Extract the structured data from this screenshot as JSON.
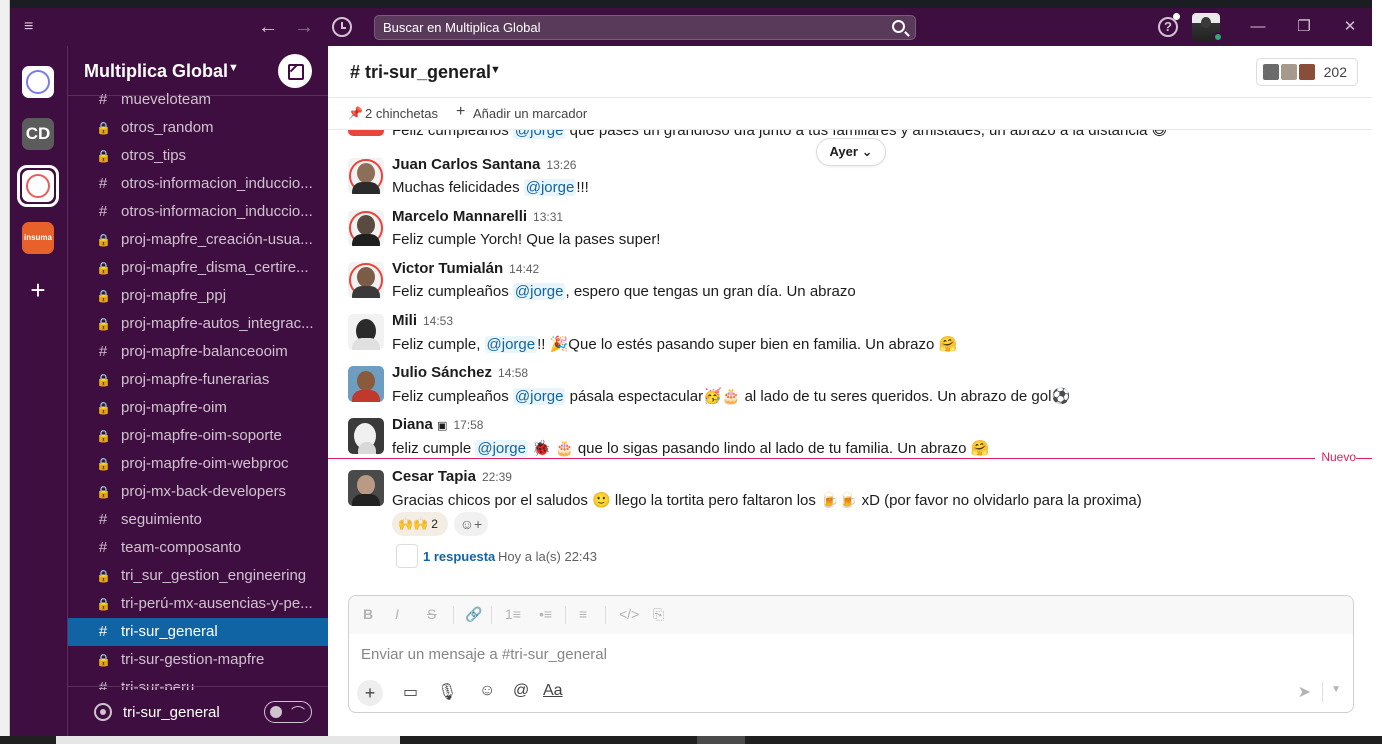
{
  "titlebar": {
    "search_placeholder": "Buscar en Multiplica Global",
    "back_icon": "arrow-left",
    "forward_icon": "arrow-right",
    "history_icon": "clock",
    "help_icon": "question",
    "minimize": "—",
    "maximize": "❐",
    "close": "✕"
  },
  "rail": {
    "workspaces": [
      {
        "icon": "circle-outline-blue"
      },
      {
        "label": "CD"
      },
      {
        "icon": "circle-outline-red",
        "active": true
      },
      {
        "label": "insuma"
      }
    ],
    "add_label": "+"
  },
  "sidebar": {
    "workspace_name": "Multiplica Global",
    "channels": [
      {
        "prefix": "#",
        "name": "mueveloteam"
      },
      {
        "prefix": "lock",
        "name": "otros_random"
      },
      {
        "prefix": "lock",
        "name": "otros_tips"
      },
      {
        "prefix": "#",
        "name": "otros-informacion_induccio..."
      },
      {
        "prefix": "#",
        "name": "otros-informacion_induccio..."
      },
      {
        "prefix": "lock",
        "name": "proj-mapfre_creación-usua..."
      },
      {
        "prefix": "lock",
        "name": "proj-mapfre_disma_certire..."
      },
      {
        "prefix": "lock",
        "name": "proj-mapfre_ppj"
      },
      {
        "prefix": "lock",
        "name": "proj-mapfre-autos_integrac..."
      },
      {
        "prefix": "#",
        "name": "proj-mapfre-balanceooim"
      },
      {
        "prefix": "lock",
        "name": "proj-mapfre-funerarias"
      },
      {
        "prefix": "lock",
        "name": "proj-mapfre-oim"
      },
      {
        "prefix": "lock",
        "name": "proj-mapfre-oim-soporte"
      },
      {
        "prefix": "lock",
        "name": "proj-mapfre-oim-webproc"
      },
      {
        "prefix": "lock",
        "name": "proj-mx-back-developers"
      },
      {
        "prefix": "#",
        "name": "seguimiento"
      },
      {
        "prefix": "#",
        "name": "team-composanto"
      },
      {
        "prefix": "lock",
        "name": "tri_sur_gestion_engineering"
      },
      {
        "prefix": "lock",
        "name": "tri-perú-mx-ausencias-y-pe..."
      },
      {
        "prefix": "#",
        "name": "tri-sur_general",
        "active": true
      },
      {
        "prefix": "lock",
        "name": "tri-sur-gestion-mapfre"
      },
      {
        "prefix": "#",
        "name": "tri-sur-peru"
      }
    ],
    "footer_label": "tri-sur_general"
  },
  "channel": {
    "title": "# tri-sur_general",
    "member_count": "202",
    "pins_label": "2 chinchetas",
    "add_bookmark_label": "Añadir un marcador",
    "day_label": "Ayer"
  },
  "messages": [
    {
      "author": "",
      "time": "",
      "text_before": "Feliz cumpleaños ",
      "mention": "@jorge",
      "text_after": " que pases un grandioso día junto a tus familiares y amistades, un abrazo a la distancia ",
      "emoji": "😄"
    },
    {
      "author": "Juan Carlos Santana",
      "time": "13:26",
      "text_before": "Muchas felicidades ",
      "mention": "@jorge",
      "text_after": "!!!",
      "emoji": ""
    },
    {
      "author": "Marcelo Mannarelli",
      "time": "13:31",
      "text_before": "Feliz cumple Yorch! Que la pases super!",
      "mention": "",
      "text_after": "",
      "emoji": ""
    },
    {
      "author": "Victor Tumialán",
      "time": "14:42",
      "text_before": "Feliz cumpleaños ",
      "mention": "@jorge",
      "text_after": ", espero que tengas un gran día. Un abrazo",
      "emoji": ""
    },
    {
      "author": "Mili",
      "time": "14:53",
      "text_before": "Feliz cumple, ",
      "mention": "@jorge",
      "text_after": "!! 🎉Que lo estés pasando super bien en familia. Un abrazo ",
      "emoji": "🤗"
    },
    {
      "author": "Julio Sánchez",
      "time": "14:58",
      "text_before": "Feliz cumpleaños ",
      "mention": "@jorge",
      "text_after": " pásala espectacular🥳🎂 al lado de tu seres queridos. Un abrazo de gol",
      "emoji": "⚽"
    },
    {
      "author": "Diana",
      "time": "17:58",
      "text_before": "feliz cumple ",
      "mention": "@jorge",
      "text_after": " 🐞 🎂  que lo sigas pasando lindo al lado de tu familia. Un abrazo ",
      "emoji": "🤗"
    },
    {
      "author": "Cesar Tapia",
      "time": "22:39",
      "text_before": "Gracias chicos por el saludos 🙂 llego la tortita pero faltaron los 🍺🍺 xD (por favor no olvidarlo para la proxima)",
      "mention": "",
      "text_after": "",
      "emoji": ""
    }
  ],
  "new_label": "Nuevo",
  "reaction": {
    "emoji": "🙌🙌",
    "count": "2"
  },
  "thread": {
    "count_label": "1 respuesta",
    "time_label": "Hoy a la(s) 22:43"
  },
  "composer": {
    "placeholder": "Enviar un mensaje a #tri-sur_general",
    "format_buttons": [
      "B",
      "I",
      "S",
      "🔗",
      "1≡",
      "•≡",
      "≡",
      "</>",
      "⎘"
    ],
    "tools": [
      "+",
      "▭",
      "🎙",
      "☺",
      "@",
      "Aa"
    ]
  }
}
